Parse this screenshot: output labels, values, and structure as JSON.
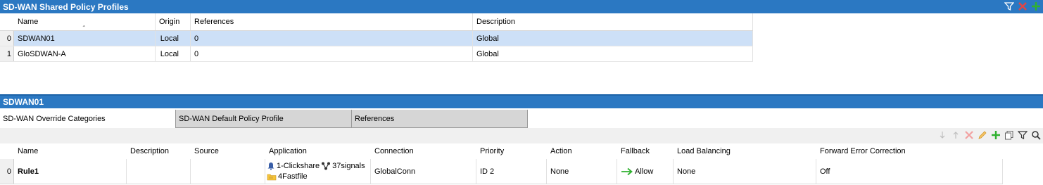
{
  "top_panel": {
    "title": "SD-WAN Shared Policy Profiles",
    "icons": [
      "filter-icon",
      "delete-icon",
      "add-icon"
    ],
    "columns": [
      "Name",
      "Origin",
      "References",
      "Description"
    ],
    "rows": [
      {
        "index": "0",
        "name": "SDWAN01",
        "origin": "Local",
        "references": "0",
        "description": "Global",
        "selected": true
      },
      {
        "index": "1",
        "name": "GloSDWAN-A",
        "origin": "Local",
        "references": "0",
        "description": "Global",
        "selected": false
      }
    ]
  },
  "detail_panel": {
    "title": "SDWAN01",
    "tabs": [
      "SD-WAN Override Categories",
      "SD-WAN Default Policy Profile",
      "References"
    ],
    "active_tab": 0,
    "toolbar_icons": [
      "move-down-icon",
      "move-up-icon",
      "delete-icon",
      "edit-icon",
      "add-icon",
      "copy-icon",
      "filter-icon",
      "search-icon"
    ],
    "columns": [
      "Name",
      "Description",
      "Source",
      "Application",
      "Connection",
      "Priority",
      "Action",
      "Fallback",
      "Load Balancing",
      "Forward Error Correction"
    ],
    "rows": [
      {
        "index": "0",
        "name": "Rule1",
        "description": "",
        "source": "",
        "applications": [
          {
            "label": "1-Clickshare",
            "icon": "bell-icon"
          },
          {
            "label": "37signals",
            "icon": "network-icon"
          },
          {
            "label": "4Fastfile",
            "icon": "folder-icon"
          }
        ],
        "connection": "GlobalConn",
        "priority": "ID 2",
        "action": "None",
        "fallback": "Allow",
        "fallback_icon": "arrow-right-icon",
        "load_balancing": "None",
        "fec": "Off"
      }
    ]
  },
  "colors": {
    "title_bar": "#2b78c2",
    "selected_row": "#cde0f7",
    "delete": "#e04646",
    "add": "#2fb12f",
    "fallback_arrow": "#2fb12f"
  }
}
